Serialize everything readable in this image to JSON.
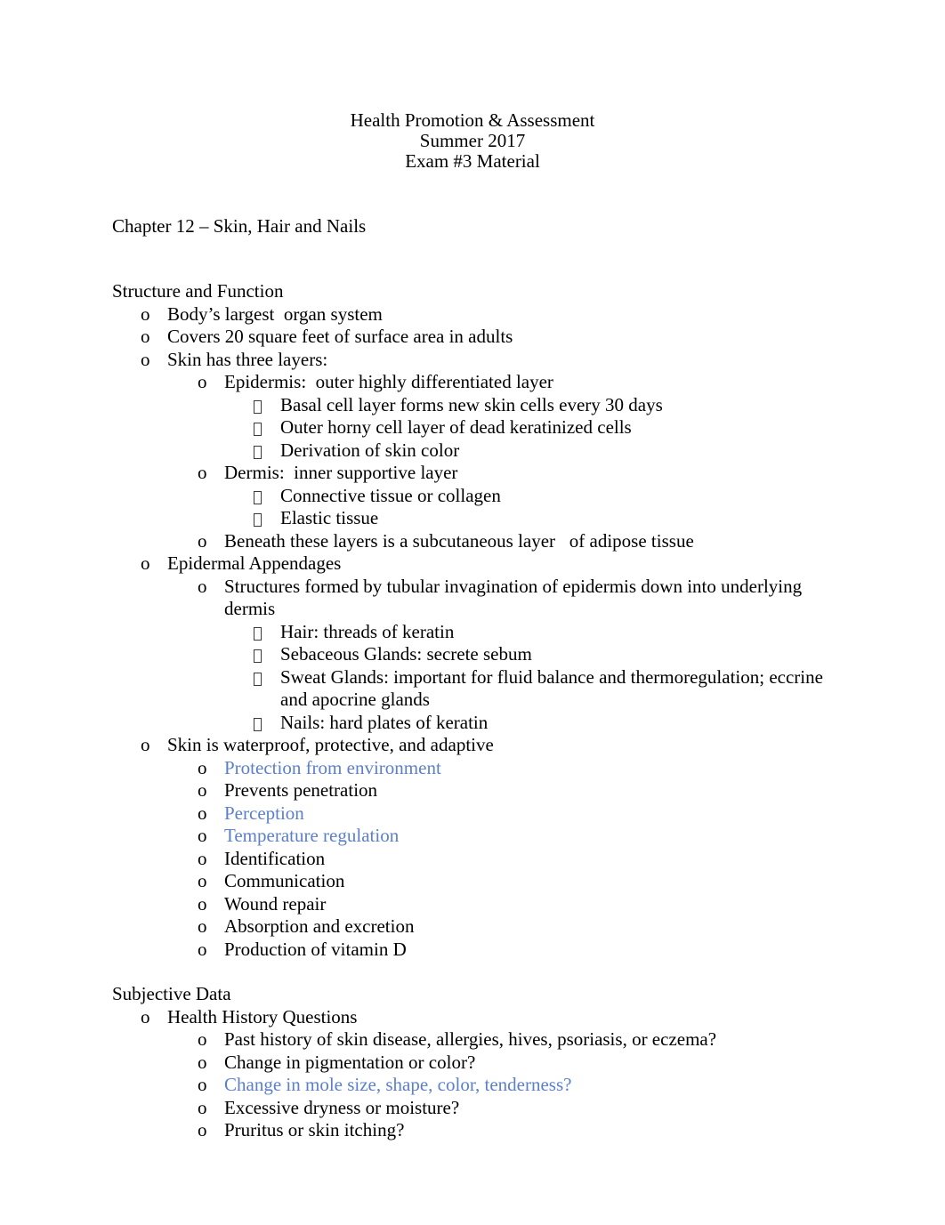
{
  "document": {
    "header": {
      "line1": "Health Promotion & Assessment",
      "line2": "Summer 2017",
      "line3": "Exam #3 Material"
    },
    "chapter_heading": "Chapter 12 – Skin, Hair and Nails",
    "sections": [
      {
        "heading": "Structure and Function",
        "items": [
          {
            "level": 1,
            "bullet": "o",
            "text": "Body’s largest  organ system",
            "color": "black"
          },
          {
            "level": 1,
            "bullet": "o",
            "text": "Covers 20 square feet of surface area in adults",
            "color": "black"
          },
          {
            "level": 1,
            "bullet": "o",
            "text": "Skin has three layers:",
            "color": "black"
          },
          {
            "level": 2,
            "bullet": "o",
            "text": "Epidermis:  outer highly differentiated layer",
            "color": "black"
          },
          {
            "level": 3,
            "bullet": "box",
            "text": "Basal cell layer forms new skin cells every 30 days",
            "color": "black"
          },
          {
            "level": 3,
            "bullet": "box",
            "text": "Outer horny cell layer of dead keratinized cells",
            "color": "black"
          },
          {
            "level": 3,
            "bullet": "box",
            "text": "Derivation of skin color",
            "color": "black"
          },
          {
            "level": 2,
            "bullet": "o",
            "text": "Dermis:  inner supportive layer",
            "color": "black"
          },
          {
            "level": 3,
            "bullet": "box",
            "text": "Connective tissue or collagen",
            "color": "black"
          },
          {
            "level": 3,
            "bullet": "box",
            "text": "Elastic tissue",
            "color": "black"
          },
          {
            "level": 2,
            "bullet": "o",
            "text": "Beneath these layers is a subcutaneous layer   of adipose tissue",
            "color": "black"
          },
          {
            "level": 1,
            "bullet": "o",
            "text": "Epidermal Appendages",
            "color": "black"
          },
          {
            "level": 2,
            "bullet": "o",
            "text": "Structures formed by tubular invagination of epidermis down into underlying dermis",
            "color": "black"
          },
          {
            "level": 3,
            "bullet": "box",
            "text": "Hair: threads of keratin",
            "color": "black"
          },
          {
            "level": 3,
            "bullet": "box",
            "text": "Sebaceous Glands: secrete sebum",
            "color": "black"
          },
          {
            "level": 3,
            "bullet": "box",
            "text": "Sweat Glands: important for fluid balance and thermoregulation; eccrine and apocrine glands",
            "color": "black"
          },
          {
            "level": 3,
            "bullet": "box",
            "text": "Nails: hard plates of keratin",
            "color": "black"
          },
          {
            "level": 1,
            "bullet": "o",
            "text": "Skin is waterproof, protective, and adaptive",
            "color": "black"
          },
          {
            "level": 2,
            "bullet": "o",
            "text": "Protection from environment",
            "color": "blue"
          },
          {
            "level": 2,
            "bullet": "o",
            "text": "Prevents penetration",
            "color": "black"
          },
          {
            "level": 2,
            "bullet": "o",
            "text": "Perception",
            "color": "blue"
          },
          {
            "level": 2,
            "bullet": "o",
            "text": "Temperature regulation",
            "color": "blue"
          },
          {
            "level": 2,
            "bullet": "o",
            "text": "Identification",
            "color": "black"
          },
          {
            "level": 2,
            "bullet": "o",
            "text": "Communication",
            "color": "black"
          },
          {
            "level": 2,
            "bullet": "o",
            "text": "Wound repair",
            "color": "black"
          },
          {
            "level": 2,
            "bullet": "o",
            "text": "Absorption and excretion",
            "color": "black"
          },
          {
            "level": 2,
            "bullet": "o",
            "text": "Production of vitamin D",
            "color": "black"
          }
        ]
      },
      {
        "heading": "Subjective Data",
        "items": [
          {
            "level": 1,
            "bullet": "o",
            "text": "Health History Questions",
            "color": "black"
          },
          {
            "level": 2,
            "bullet": "o",
            "text": "Past history of skin disease, allergies, hives, psoriasis, or eczema?",
            "color": "black"
          },
          {
            "level": 2,
            "bullet": "o",
            "text": "Change in pigmentation or color?",
            "color": "black"
          },
          {
            "level": 2,
            "bullet": "o",
            "text": "Change in mole size, shape, color, tenderness?",
            "color": "blue"
          },
          {
            "level": 2,
            "bullet": "o",
            "text": "Excessive dryness or moisture?",
            "color": "black"
          },
          {
            "level": 2,
            "bullet": "o",
            "text": "Pruritus or skin itching?",
            "color": "black"
          }
        ]
      }
    ],
    "colors": {
      "text": "#000000",
      "link_blue": "#5b7fc9",
      "background": "#ffffff"
    }
  }
}
